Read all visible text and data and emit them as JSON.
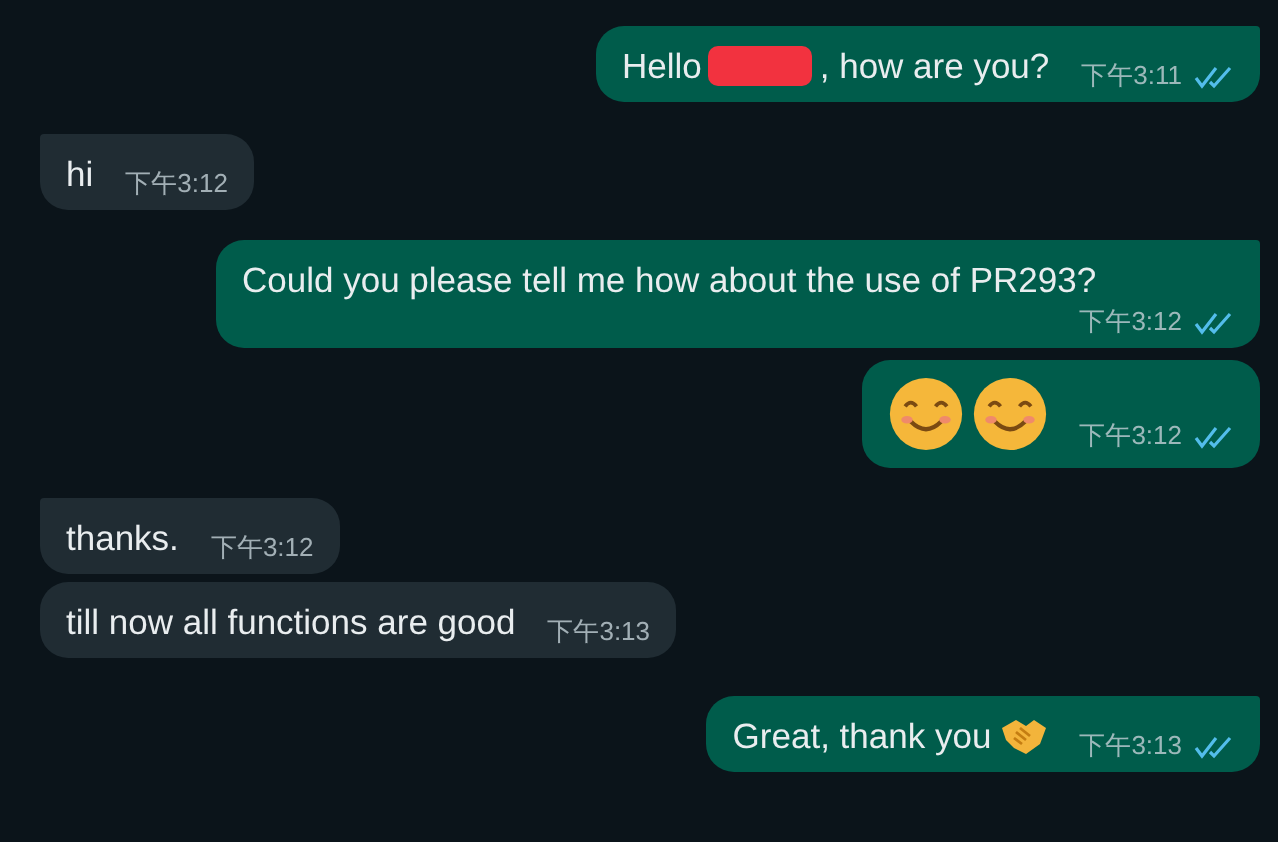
{
  "messages": [
    {
      "kind": "outgoing",
      "tail": true,
      "parts": [
        {
          "kind": "text",
          "text": "Hello"
        },
        {
          "kind": "redaction"
        },
        {
          "kind": "text",
          "text": ", how are you?"
        }
      ],
      "time": "下午3:11",
      "read": true
    },
    {
      "kind": "incoming",
      "tail": true,
      "parts": [
        {
          "kind": "text",
          "text": "hi"
        }
      ],
      "time": "下午3:12"
    },
    {
      "kind": "outgoing",
      "tail": true,
      "parts": [
        {
          "kind": "text",
          "text": "Could you please tell me how about the use of PR293?"
        }
      ],
      "time": "下午3:12",
      "read": true
    },
    {
      "kind": "outgoing",
      "tail": false,
      "parts": [
        {
          "kind": "smiley"
        },
        {
          "kind": "smiley"
        }
      ],
      "time": "下午3:12",
      "read": true
    },
    {
      "kind": "incoming",
      "tail": true,
      "parts": [
        {
          "kind": "text",
          "text": "thanks."
        }
      ],
      "time": "下午3:12"
    },
    {
      "kind": "incoming",
      "tail": false,
      "parts": [
        {
          "kind": "text",
          "text": "till now all functions are good"
        }
      ],
      "time": "下午3:13"
    },
    {
      "kind": "outgoing",
      "tail": true,
      "parts": [
        {
          "kind": "text",
          "text": "Great, thank you"
        },
        {
          "kind": "handshake"
        }
      ],
      "time": "下午3:13",
      "read": true
    }
  ]
}
